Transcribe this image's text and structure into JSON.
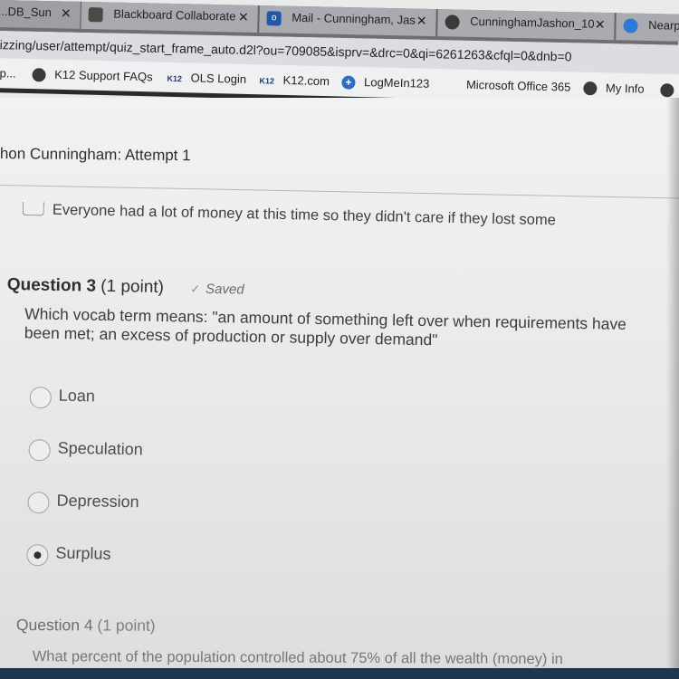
{
  "browser": {
    "tabs": [
      {
        "label": "...DB_Sun",
        "icon": "generic-tab-icon",
        "close": "✕"
      },
      {
        "label": "Blackboard Collaborate",
        "icon": "blackboard-icon",
        "close": "✕"
      },
      {
        "label": "Mail - Cunningham, Jas",
        "icon": "outlook-icon",
        "close": "✕"
      },
      {
        "label": "CunninghamJashon_10",
        "icon": "globe-icon",
        "close": "✕"
      },
      {
        "label": "Nearp",
        "icon": "nearpod-icon",
        "close": ""
      }
    ],
    "url": "izzing/user/attempt/quiz_start_frame_auto.d2l?ou=709085&isprv=&drc=0&qi=6261263&cfql=0&dnb=0",
    "bookmarks": [
      {
        "label": "p...",
        "icon": "none"
      },
      {
        "label": "K12 Support FAQs",
        "icon": "globe-icon"
      },
      {
        "label": "OLS Login",
        "icon": "k12-icon"
      },
      {
        "label": "K12.com",
        "icon": "k12-icon"
      },
      {
        "label": "LogMeIn123",
        "icon": "plus-circle-icon"
      },
      {
        "label": "Microsoft Office 365",
        "icon": "microsoft-icon"
      },
      {
        "label": "My Info",
        "icon": "globe-icon"
      },
      {
        "label": "",
        "icon": "globe-icon"
      }
    ],
    "k12_badge": "K12"
  },
  "quiz": {
    "attempt_header": "hon Cunningham: Attempt 1",
    "previous_option": "Everyone had a lot of money at this time so they didn't care if they lost some",
    "question3": {
      "title": "Question 3",
      "points": "(1 point)",
      "status": "Saved",
      "status_icon": "✓",
      "text": "Which vocab term means: \"an amount of something left over when requirements have been met; an excess of production or supply over demand\"",
      "options": [
        {
          "label": "Loan",
          "selected": false
        },
        {
          "label": "Speculation",
          "selected": false
        },
        {
          "label": "Depression",
          "selected": false
        },
        {
          "label": "Surplus",
          "selected": true
        }
      ]
    },
    "question4": {
      "title": "Question 4",
      "points": "(1 point)",
      "text": "What percent of the population controlled about 75% of all the wealth (money) in"
    }
  }
}
